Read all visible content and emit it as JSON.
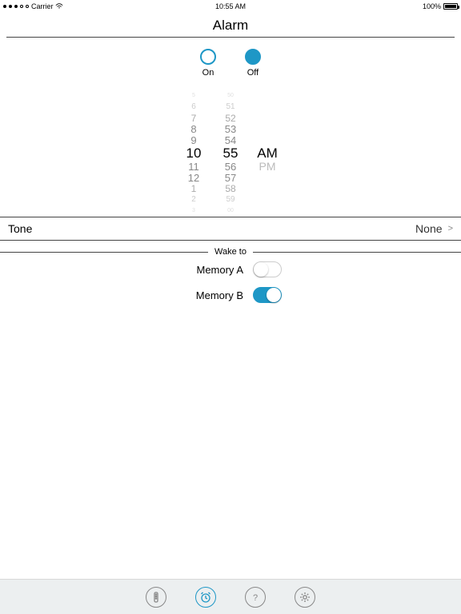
{
  "statusbar": {
    "carrier": "Carrier",
    "time": "10:55 AM",
    "battery": "100%"
  },
  "title": "Alarm",
  "onoff": {
    "on_label": "On",
    "off_label": "Off",
    "value": "Off"
  },
  "time_picker": {
    "hour": 10,
    "minute": 55,
    "ampm": "AM",
    "hour_roll": [
      "5",
      "6",
      "7",
      "8",
      "9",
      "10",
      "11",
      "12",
      "1",
      "2",
      "3"
    ],
    "minute_roll": [
      "50",
      "51",
      "52",
      "53",
      "54",
      "55",
      "56",
      "57",
      "58",
      "59",
      "00"
    ],
    "ampm_other": "PM"
  },
  "tone": {
    "label": "Tone",
    "value": "None"
  },
  "wake_to": {
    "header": "Wake to",
    "items": [
      {
        "label": "Memory A",
        "on": false
      },
      {
        "label": "Memory B",
        "on": true
      }
    ]
  },
  "tabbar": {
    "items": [
      "remote",
      "alarm",
      "help",
      "settings"
    ],
    "active": "alarm"
  }
}
